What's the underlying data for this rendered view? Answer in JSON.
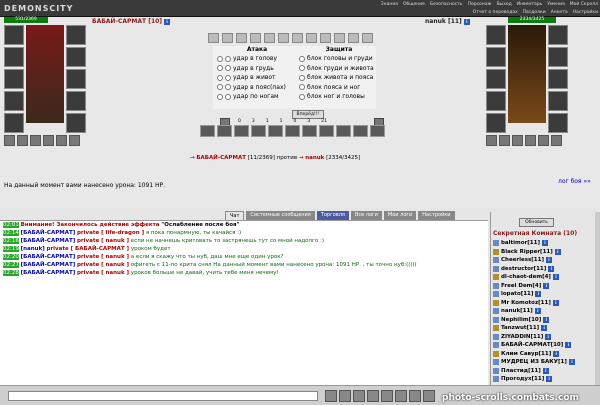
{
  "app": {
    "logo": "DEMONSCITY"
  },
  "nav": [
    "Знания",
    "Общение",
    "Безопасность",
    "Персонаж",
    "Выход",
    "Инвентарь",
    "Умения",
    "Мой Скролл",
    "Отчет о переводах",
    "Пвсдолки",
    "Анкета",
    "Настройки"
  ],
  "player_left": {
    "name": "БАБАЙ-САРМАТ",
    "level": "[10]",
    "hp": "531/2369"
  },
  "player_right": {
    "name": "nanuk",
    "level": "[11]",
    "hp": "2334/3425"
  },
  "attack": {
    "title": "Атака",
    "options": [
      "удар в голову",
      "удар в грудь",
      "удар в живот",
      "удар в пояс(пах)",
      "удар по ногам"
    ]
  },
  "defense": {
    "title": "Защита",
    "options": [
      "блок головы и груди",
      "блок груди и живота",
      "блок живота и пояса",
      "блок пояса и ног",
      "блок ног и головы"
    ]
  },
  "fight_button": "Вперёд!!!",
  "combat_stats": [
    "0",
    "3",
    "1",
    "1",
    "0",
    "3",
    "21"
  ],
  "versus": {
    "left_name": "БАБАЙ-САРМАТ",
    "left_hp": "[11/2369]",
    "word": "против",
    "right_name": "nanuk",
    "right_hp": "[2334/3425]"
  },
  "damage_text": "На данный момент вами нанесено урона: 1091 НР.",
  "log_link": "лог боя »»",
  "tabs": [
    "Чат",
    "Системные сообщения",
    "Торговля",
    "Все логи",
    "Мои логи",
    "Настройки"
  ],
  "chat": [
    {
      "time": "02:01",
      "text": "Внимание! Закончилось действие эффекта ",
      "bold": "\"Ослабление после боя\""
    },
    {
      "time": "02:14",
      "from": "[БАБАЙ-САРМАТ]",
      "priv": "private [ life-dragon ]",
      "msg": " я пока понармную, ты качайся :)"
    },
    {
      "time": "02:16",
      "from": "[БАБАЙ-САРМАТ]",
      "priv": "private [ nanuk ]",
      "msg": " если не начнешь критовать то застрянешь тут со мной надолго :)"
    },
    {
      "time": "02:19",
      "from": "[nanuk]",
      "priv": "private [ БАБАЙ-САРМАТ ]",
      "msg": " уроком будет"
    },
    {
      "time": "02:20",
      "from": "[БАБАЙ-САРМАТ]",
      "priv": "private [ nanuk ]",
      "msg": " а если я скажу что ты нуб, даш мне еще один урок?"
    },
    {
      "time": "02:27",
      "from": "[БАБАЙ-САРМАТ]",
      "priv": "private [ nanuk ]",
      "msg": " офигеть с 11-по крита снял На данный момент вами нанесено урона: 1091 НР. , ты точно нуб:((((("
    },
    {
      "time": "02:28",
      "from": "[БАБАЙ-САРМАТ]",
      "priv": "private [ nanuk ]",
      "msg": " уроков больше не давай, учить тебе меня нечему!"
    }
  ],
  "sidebar": {
    "refresh": "Обновить",
    "room_title": "Секретная Комната (10)",
    "users": [
      "baltimor[11]",
      "Black Ripper[11]",
      "Cheerless[11]",
      "destructor[11]",
      "dl-chaot-dem[4]",
      "Freel Dem[4]",
      "lopato[11]",
      "Mr Komotoz[11]",
      "nanuk[11]",
      "Nephilim[10]",
      "Tanzwut[11]",
      "ZIYADDIN[11]",
      "БАБАЙ-САРМАТ[10]",
      "Клим Савур[11]",
      "МУДРЕЦ ИЗ БАКУ[1]",
      "Пластид[11]",
      "Прогодух[11]"
    ]
  },
  "watermark": "photo-scrolls.combats.com"
}
